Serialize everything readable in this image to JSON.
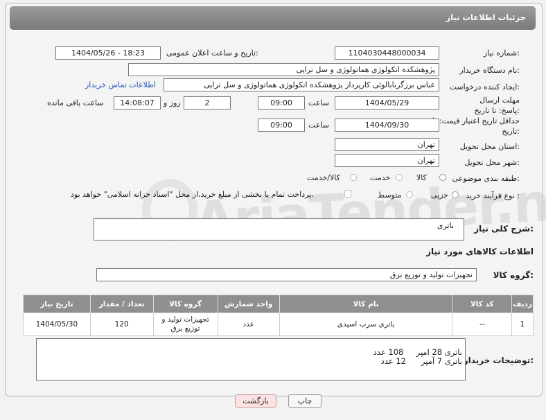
{
  "header": {
    "title": "جزئیات اطلاعات نیاز"
  },
  "form": {
    "need_number_label": "شماره نیاز:",
    "need_number": "1104030448000034",
    "announce_label": "تاریخ و ساعت اعلان عمومی:",
    "announce_value": "1404/05/26 - 18:23",
    "buyer_org_label": "نام دستگاه خریدار:",
    "buyer_org": "پژوهشکده انکولوژی هماتولوژی و سل تراپی",
    "creator_label": "ایجاد کننده درخواست:",
    "creator": "عباس برزگربابالوئی کارپرداز پژوهشکده انکولوژی هماتولوژی و سل تراپی",
    "buyer_contact_link": "اطلاعات تماس خریدار",
    "deadline_label": "مهلت ارسال پاسخ: تا تاریخ:",
    "deadline_date": "1404/05/29",
    "time_label": "ساعت",
    "deadline_time": "09:00",
    "days_value": "2",
    "days_label": "روز و",
    "remaining_time": "14:08:07",
    "remaining_label": "ساعت باقی مانده",
    "validity_label": "حداقل تاریخ اعتبار قیمت: تا تاریخ:",
    "validity_date": "1404/09/30",
    "validity_time": "09:00",
    "province_label": "استان محل تحویل:",
    "province": "تهران",
    "city_label": "شهر محل تحویل:",
    "city": "تهران",
    "category_label": "طبقه بندی موضوعی:",
    "category_options": [
      "کالا",
      "خدمت",
      "کالا/خدمت"
    ],
    "process_label": "نوع فرآیند خرید :",
    "process_options": [
      "جزیی",
      "متوسط"
    ],
    "payment_note": "پرداخت تمام یا بخشی از مبلغ خرید،از محل \"اسناد خزانه اسلامی\" خواهد بود."
  },
  "description": {
    "label": "شرح کلی نیاز:",
    "value": "باتری"
  },
  "goods": {
    "section_title": "اطلاعات کالاهای مورد نیاز",
    "group_label": "گروه کالا:",
    "group_value": "تجهیزات تولید و توزیع برق",
    "columns": [
      "ردیف",
      "کد کالا",
      "نام کالا",
      "واحد شمارش",
      "گروه کالا",
      "تعداد / مقدار",
      "تاریخ نیاز"
    ],
    "rows": [
      {
        "row": "1",
        "code": "--",
        "name": "باتری سرب اسیدی",
        "unit": "عدد",
        "group": "تجهیزات تولید و توزیع برق",
        "qty": "120",
        "date": "1404/05/30"
      }
    ]
  },
  "buyer_notes": {
    "label": "توضیحات خریدار:",
    "lines": [
      "باتری 28 امپر     108 عدد",
      "باتری 7 آمپر      12 عدد"
    ]
  },
  "buttons": {
    "print": "چاپ",
    "back": "بازگشت"
  },
  "watermark": {
    "text": "AriaTender.neT"
  }
}
